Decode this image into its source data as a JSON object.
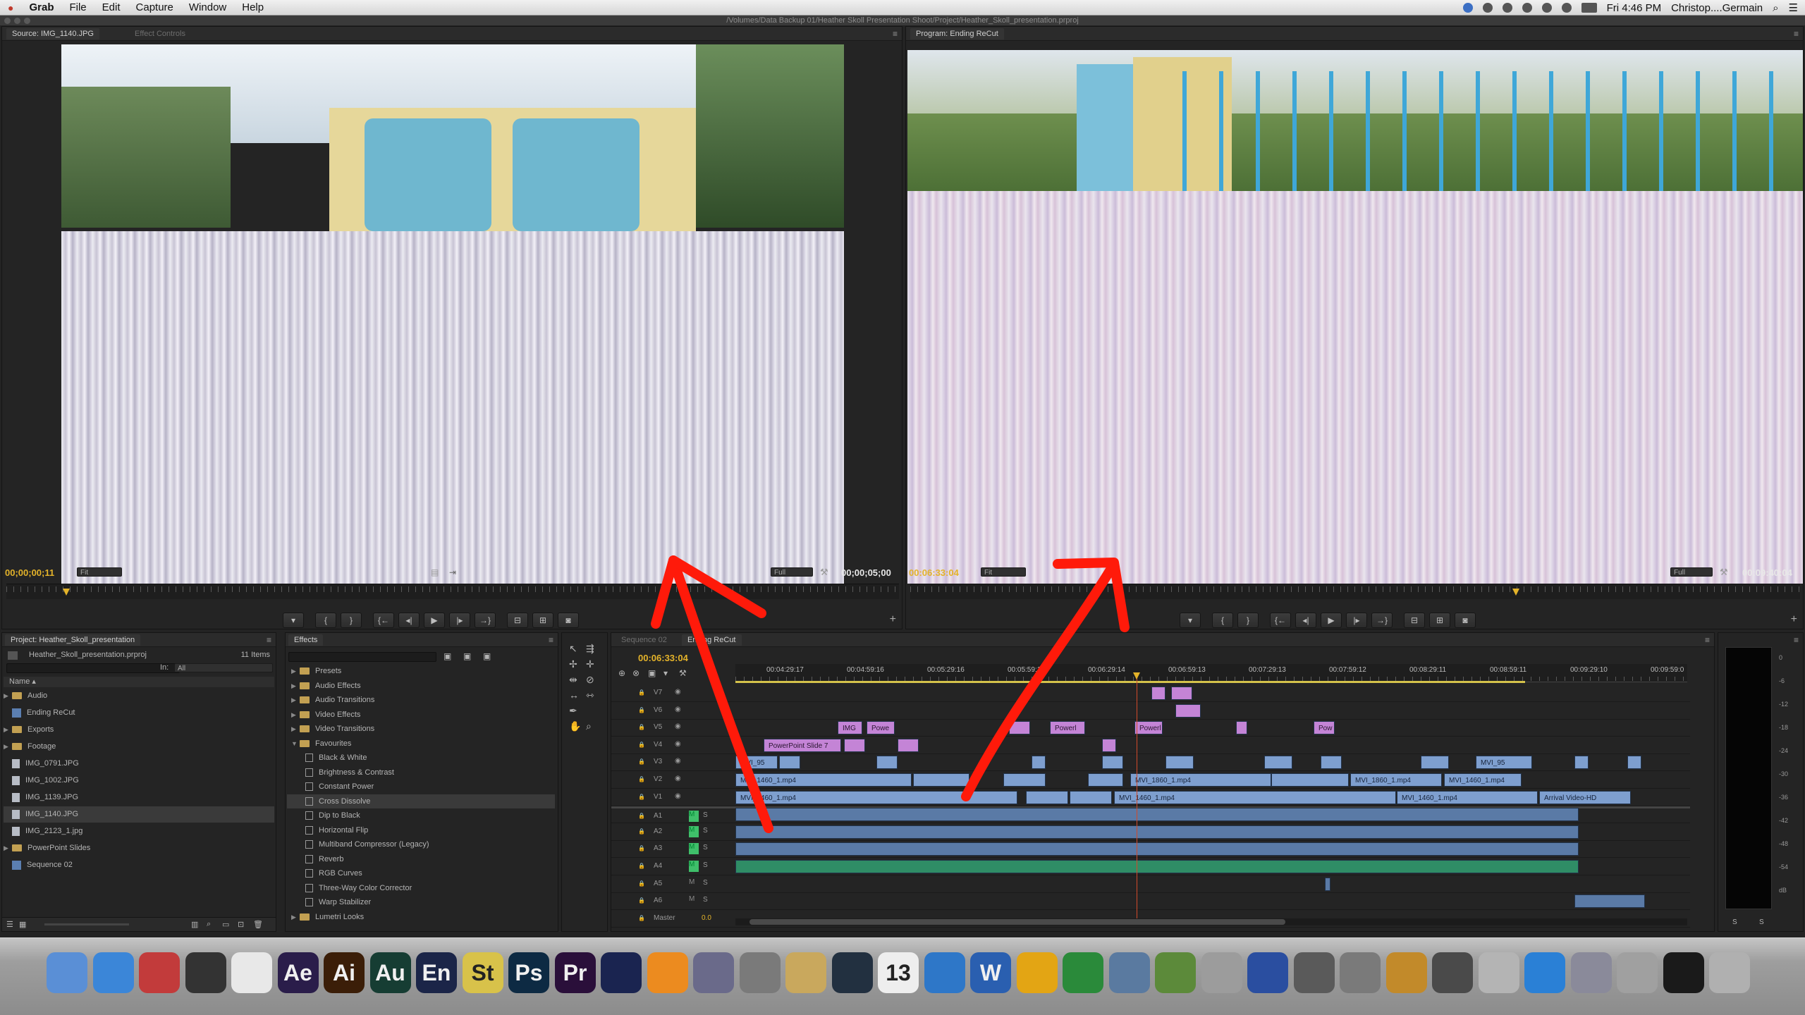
{
  "menubar": {
    "app": "Grab",
    "items": [
      "File",
      "Edit",
      "Capture",
      "Window",
      "Help"
    ],
    "clock": "Fri 4:46 PM",
    "user": "Christop....Germain"
  },
  "window": {
    "path": "/Volumes/Data Backup 01/Heather Skoll Presentation Shoot/Project/Heather_Skoll_presentation.prproj"
  },
  "source": {
    "tab": "Source: IMG_1140.JPG",
    "tab2": "Effect Controls",
    "timecode_in": "00;00;00;11",
    "zoom": "Fit",
    "quality": "Full",
    "timecode_out": "00;00;05;00"
  },
  "program": {
    "tab": "Program: Ending ReCut",
    "timecode_in": "00:06:33:04",
    "zoom": "Fit",
    "quality": "Full",
    "timecode_out": "00:09:40:04"
  },
  "project": {
    "tab": "Project: Heather_Skoll_presentation",
    "file": "Heather_Skoll_presentation.prproj",
    "count": "11 Items",
    "in_label": "In:",
    "in_value": "All",
    "name_col": "Name",
    "items": [
      "Audio",
      "Ending ReCut",
      "Exports",
      "Footage",
      "IMG_0791.JPG",
      "IMG_1002.JPG",
      "IMG_1139.JPG",
      "IMG_1140.JPG",
      "IMG_2123_1.jpg",
      "PowerPoint Slides",
      "Sequence 02"
    ]
  },
  "effects": {
    "tab": "Effects",
    "items": [
      "Presets",
      "Audio Effects",
      "Audio Transitions",
      "Video Effects",
      "Video Transitions",
      "Favourites",
      "Black & White",
      "Brightness & Contrast",
      "Constant Power",
      "Cross Dissolve",
      "Dip to Black",
      "Horizontal Flip",
      "Multiband Compressor (Legacy)",
      "Reverb",
      "RGB Curves",
      "Three-Way Color Corrector",
      "Warp Stabilizer",
      "Lumetri Looks"
    ]
  },
  "timeline": {
    "tab1": "Sequence 02",
    "tab2": "Ending ReCut",
    "timecode": "00:06:33:04",
    "ruler": [
      "00:04:29:17",
      "00:04:59:16",
      "00:05:29:16",
      "00:05:59:15",
      "00:06:29:14",
      "00:06:59:13",
      "00:07:29:13",
      "00:07:59:12",
      "00:08:29:11",
      "00:08:59:11",
      "00:09:29:10",
      "00:09:59:0"
    ],
    "tracks": [
      "V7",
      "V6",
      "V5",
      "V4",
      "V3",
      "V2",
      "V1",
      "A1",
      "A2",
      "A3",
      "A4",
      "A5",
      "A6",
      "Master"
    ],
    "master_val": "0.0",
    "clip_labels": {
      "c1": "MVI_1460_1.mp4",
      "c2": "MVI_1460_1.mp4",
      "c3": "MVI_1460_1.mp4",
      "c4": "MVI_1460_1.mp4",
      "c5": "MVI_1460_1.mp4",
      "c6": "Arrival Video-HD",
      "c7": "PowerPoint Slide 7",
      "c8": "IMG",
      "c9": "Powe",
      "c10": "Powerl",
      "c11": "Powerl",
      "c12": "Pow",
      "c13": "MVI_95",
      "c14": "MVI_95",
      "c15": "MVI_1860_1.mp4",
      "c16": "MVI_1860_1.mp4"
    }
  },
  "meter": {
    "labels": [
      "0",
      "-6",
      "-12",
      "-18",
      "-24",
      "-30",
      "-36",
      "-42",
      "-48",
      "-54",
      "dB"
    ],
    "s_label": "S",
    "s_label2": "S"
  },
  "dock": {
    "icons": [
      {
        "label": "",
        "name": "finder-icon",
        "bg": "#5a8fd6"
      },
      {
        "label": "",
        "name": "safari-icon",
        "bg": "#3b86d8"
      },
      {
        "label": "",
        "name": "photobooth-icon",
        "bg": "#c23b3b"
      },
      {
        "label": "",
        "name": "fcp-icon",
        "bg": "#333333"
      },
      {
        "label": "",
        "name": "acrobat-icon",
        "bg": "#e8e8e8"
      },
      {
        "label": "Ae",
        "name": "after-effects-icon",
        "bg": "#2a1d4a"
      },
      {
        "label": "Ai",
        "name": "illustrator-icon",
        "bg": "#3b1e08"
      },
      {
        "label": "Au",
        "name": "audition-icon",
        "bg": "#163d33"
      },
      {
        "label": "En",
        "name": "encore-icon",
        "bg": "#1b2548"
      },
      {
        "label": "St",
        "name": "story-icon",
        "bg": "#d8c24a"
      },
      {
        "label": "Ps",
        "name": "photoshop-icon",
        "bg": "#0d2a43"
      },
      {
        "label": "Pr",
        "name": "premiere-icon",
        "bg": "#2a0f3a"
      },
      {
        "label": "",
        "name": "prelude-icon",
        "bg": "#1a2450"
      },
      {
        "label": "",
        "name": "vlc-icon",
        "bg": "#ec8b1f"
      },
      {
        "label": "",
        "name": "dvd-icon",
        "bg": "#6a6a8a"
      },
      {
        "label": "",
        "name": "preview-icon",
        "bg": "#7a7a7a"
      },
      {
        "label": "",
        "name": "address-book-icon",
        "bg": "#c9a85d"
      },
      {
        "label": "",
        "name": "cinema4d-icon",
        "bg": "#223040"
      },
      {
        "label": "13",
        "name": "calendar-icon",
        "bg": "#eeeeee"
      },
      {
        "label": "",
        "name": "itunes-icon",
        "bg": "#2e77c8"
      },
      {
        "label": "W",
        "name": "word-icon",
        "bg": "#2a5fb0"
      },
      {
        "label": "",
        "name": "outlook-icon",
        "bg": "#e3a514"
      },
      {
        "label": "",
        "name": "excel-icon",
        "bg": "#2a8a3a"
      },
      {
        "label": "",
        "name": "starcraft-icon",
        "bg": "#5a7aa0"
      },
      {
        "label": "",
        "name": "minecraft-icon",
        "bg": "#5c8a3a"
      },
      {
        "label": "",
        "name": "calculator-icon",
        "bg": "#9c9c9c"
      },
      {
        "label": "",
        "name": "cyberduck-icon",
        "bg": "#2a4ea0"
      },
      {
        "label": "",
        "name": "steam-icon",
        "bg": "#5a5a5a"
      },
      {
        "label": "",
        "name": "system-prefs-icon",
        "bg": "#7a7a7a"
      },
      {
        "label": "",
        "name": "utilities-icon",
        "bg": "#c28a2a"
      },
      {
        "label": "",
        "name": "handbrake-icon",
        "bg": "#4a4a4a"
      },
      {
        "label": "",
        "name": "preview2-icon",
        "bg": "#b4b4b4"
      },
      {
        "label": "",
        "name": "dropbox-icon",
        "bg": "#2a80d6"
      },
      {
        "label": "",
        "name": "screenshot-icon",
        "bg": "#8a8a9a"
      },
      {
        "label": "",
        "name": "tools-icon",
        "bg": "#a0a0a0"
      },
      {
        "label": "",
        "name": "activity-monitor-icon",
        "bg": "#1a1a1a"
      },
      {
        "label": "",
        "name": "trash-icon",
        "bg": "#b0b0b0"
      }
    ]
  }
}
